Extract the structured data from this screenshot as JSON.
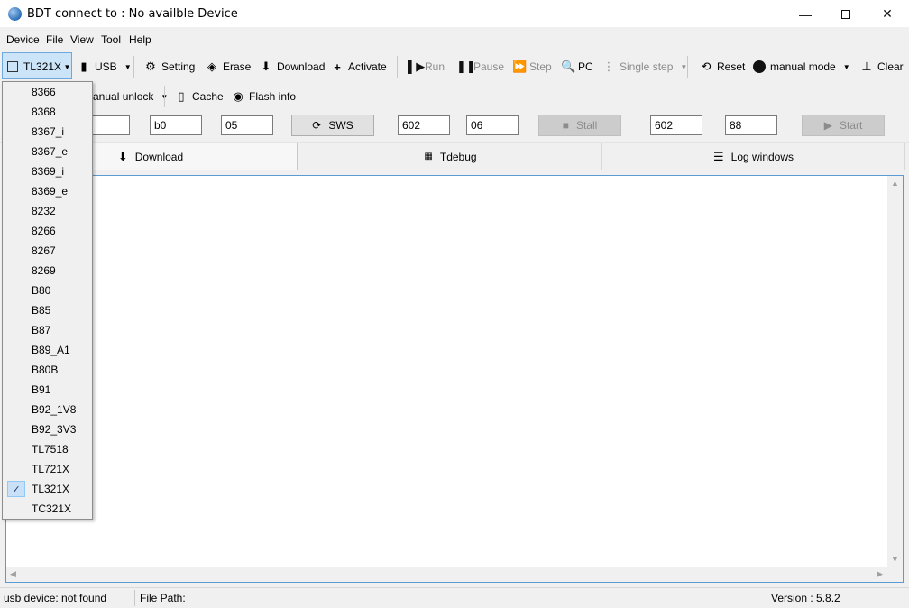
{
  "window": {
    "title": "BDT connect to : No availble Device",
    "minimize_icon": "minimize-icon",
    "maximize_icon": "maximize-icon",
    "close_icon": "close-icon"
  },
  "menu": [
    "Device",
    "File",
    "View",
    "Tool",
    "Help"
  ],
  "toolbar": {
    "device_selected": "TL321X",
    "interface": "USB",
    "setting": "Setting",
    "erase": "Erase",
    "download": "Download",
    "activate": "Activate",
    "run": "Run",
    "pause": "Pause",
    "step": "Step",
    "pc": "PC",
    "single_step": "Single step",
    "reset": "Reset",
    "mode": "manual mode",
    "clear": "Clear"
  },
  "toolbar2": {
    "unlock": "anual unlock",
    "cache": "Cache",
    "flash_info": "Flash info"
  },
  "row3": {
    "field1": "",
    "field2": "b0",
    "field3": "05",
    "sws_button": "SWS",
    "field4": "602",
    "field5": "06",
    "stall_button": "Stall",
    "field6": "602",
    "field7": "88",
    "start_button": "Start"
  },
  "tabs": {
    "download": "Download",
    "tdebug": "Tdebug",
    "log": "Log windows"
  },
  "dropdown": {
    "items": [
      "8366",
      "8368",
      "8367_i",
      "8367_e",
      "8369_i",
      "8369_e",
      "8232",
      "8266",
      "8267",
      "8269",
      "B80",
      "B85",
      "B87",
      "B89_A1",
      "B80B",
      "B91",
      "B92_1V8",
      "B92_3V3",
      "TL7518",
      "TL721X",
      "TL321X",
      "TC321X"
    ],
    "checked": "TL321X"
  },
  "status": {
    "usb": "usb device: not found",
    "file_path": "File Path:",
    "version": "Version : 5.8.2"
  }
}
